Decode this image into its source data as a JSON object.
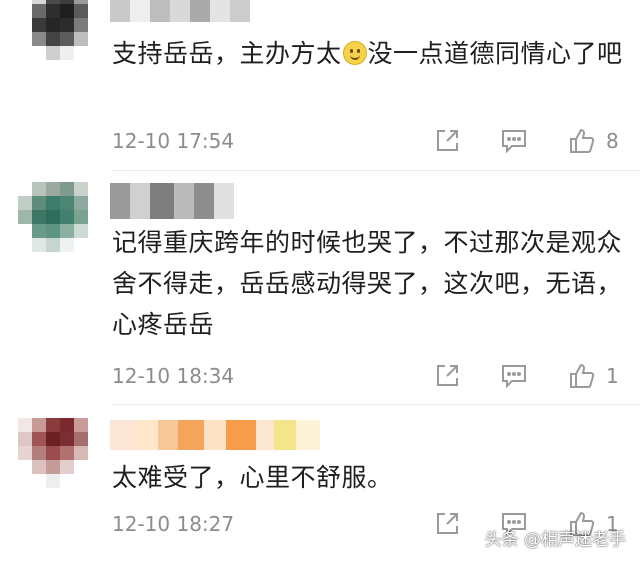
{
  "comments": [
    {
      "text_before": "支持岳岳，主办方太",
      "emoji": "smile-emoji",
      "text_after": "没一点道德同情心了吧",
      "time": "12-10 17:54",
      "likes": "8"
    },
    {
      "text": "记得重庆跨年的时候也哭了，不过那次是观众舍不得走，岳岳感动得哭了，这次吧，无语，心疼岳岳",
      "time": "12-10 18:34",
      "likes": "1"
    },
    {
      "text": "太难受了，心里不舒服。",
      "time": "12-10 18:27",
      "likes": "1"
    }
  ],
  "watermark": "头条 @相声迷老手",
  "colors": {
    "text": "#1f1f1f",
    "meta": "#8c8c8c",
    "icon": "#9a9a9a"
  }
}
